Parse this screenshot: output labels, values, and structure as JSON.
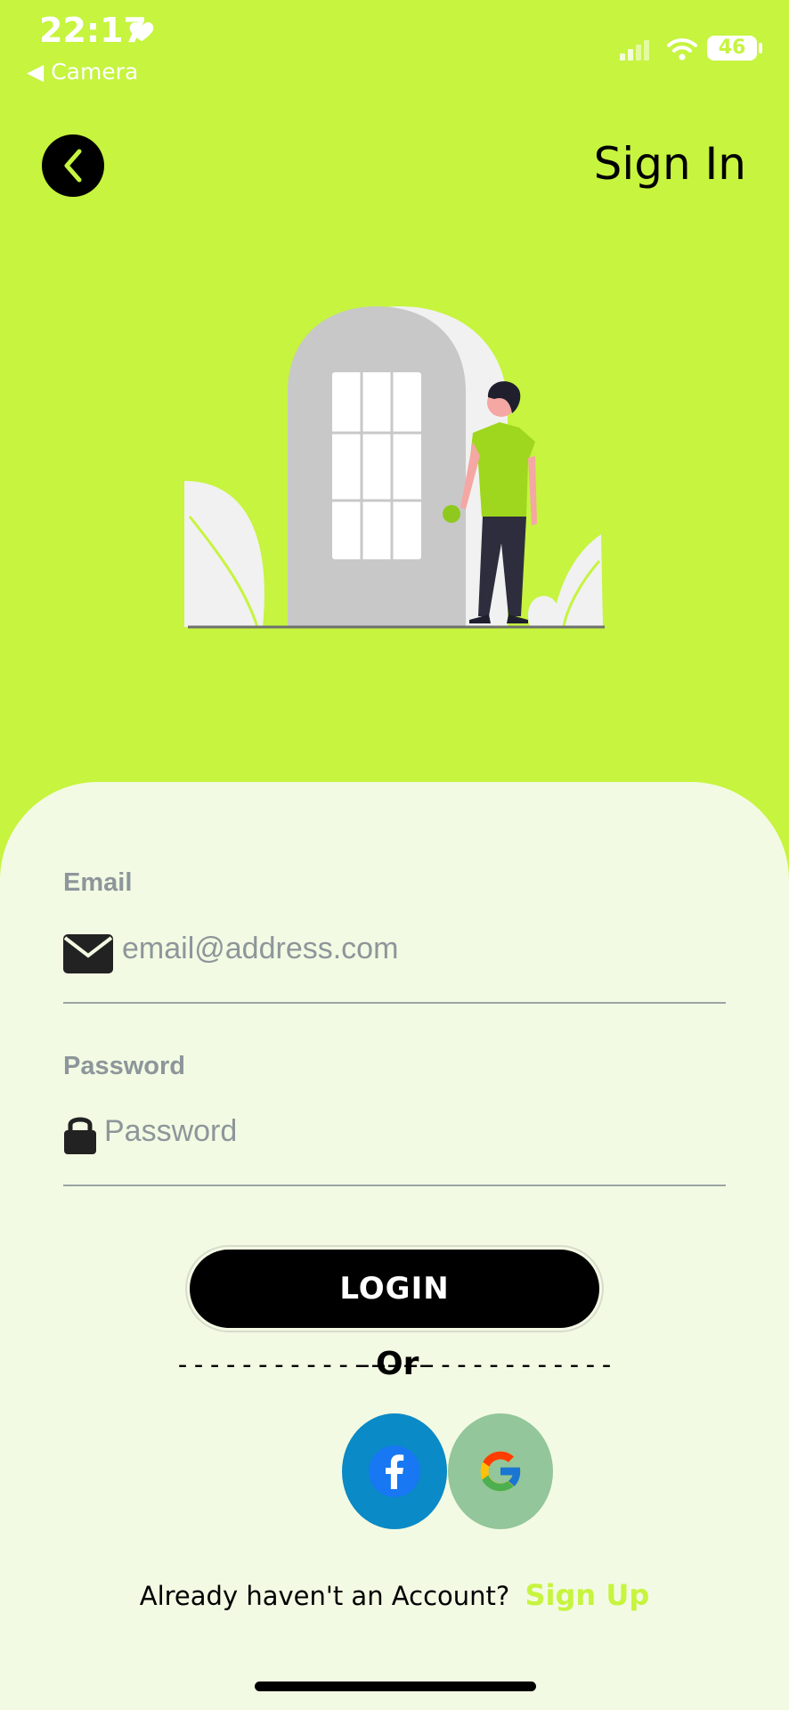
{
  "status_bar": {
    "time": "22:17",
    "back_app": "◀ Camera",
    "battery": "46"
  },
  "header": {
    "title": "Sign In"
  },
  "form": {
    "email_label": "Email",
    "email_placeholder": "email@address.com",
    "password_label": "Password",
    "password_placeholder": "Password"
  },
  "actions": {
    "login_label": "LOGIN",
    "divider_left": "----------------",
    "or_label": "Or",
    "divider_right": "----------------"
  },
  "footer": {
    "prompt": "Already haven't an Account?",
    "signup_label": "Sign Up"
  },
  "colors": {
    "accent": "#c6f43f",
    "sheet": "#f3fae3",
    "facebook": "#0a8ac6",
    "google_bg": "#93c69a"
  }
}
